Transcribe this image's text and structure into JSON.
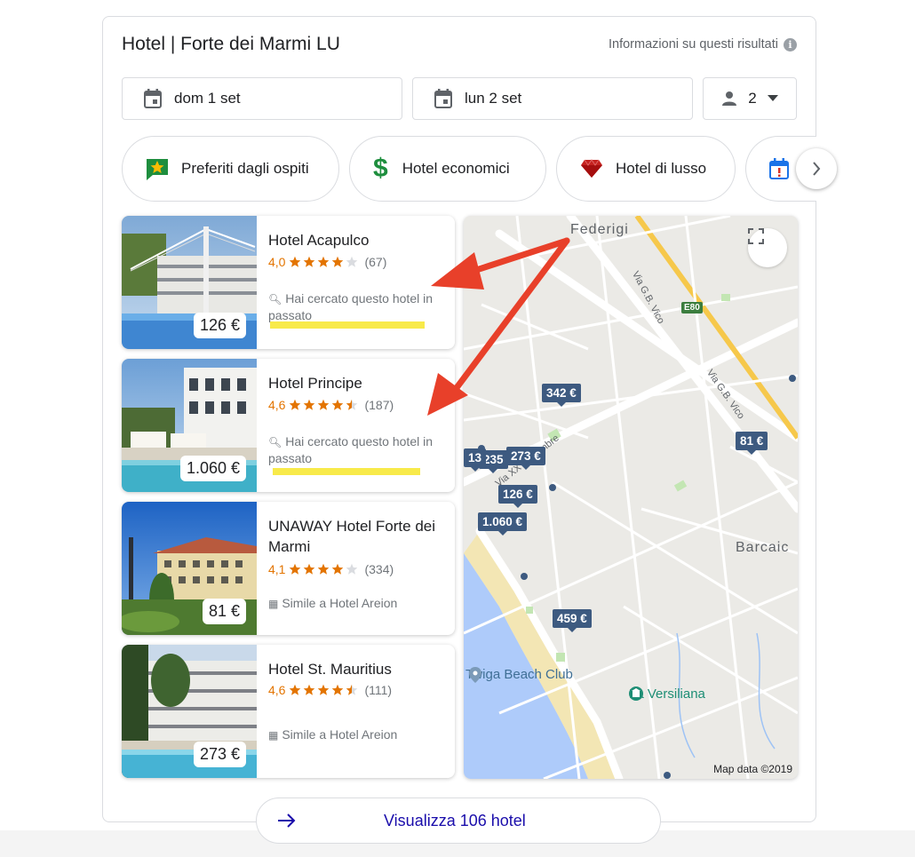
{
  "header": {
    "title": "Hotel | Forte dei Marmi LU",
    "info_link": "Informazioni su questi risultati",
    "info_icon": "info-icon"
  },
  "search": {
    "checkin": "dom 1 set",
    "checkout": "lun 2 set",
    "guests": "2"
  },
  "filters": [
    {
      "label": "Preferiti dagli ospiti",
      "icon": "star-bubble-icon"
    },
    {
      "label": "Hotel economici",
      "icon": "dollar-icon"
    },
    {
      "label": "Hotel di lusso",
      "icon": "gem-icon"
    },
    {
      "label": "",
      "icon": "calendar-alert-icon"
    }
  ],
  "hotels": [
    {
      "name": "Hotel Acapulco",
      "rating": "4,0",
      "stars": 4.0,
      "reviews": "(67)",
      "note": "Hai cercato questo hotel in passato",
      "note_icon": "search-icon",
      "price": "126 €"
    },
    {
      "name": "Hotel Principe",
      "rating": "4,6",
      "stars": 4.6,
      "reviews": "(187)",
      "note": "Hai cercato questo hotel in passato",
      "note_icon": "search-icon",
      "price": "1.060 €"
    },
    {
      "name": "UNAWAY Hotel Forte dei Marmi",
      "rating": "4,1",
      "stars": 4.1,
      "reviews": "(334)",
      "note": "Simile a Hotel Areion",
      "note_icon": "building-icon",
      "price": "81 €"
    },
    {
      "name": "Hotel St. Mauritius",
      "rating": "4,6",
      "stars": 4.6,
      "reviews": "(111)",
      "note": "Simile a Hotel Areion",
      "note_icon": "building-icon",
      "price": "273 €"
    }
  ],
  "map": {
    "labels": [
      "Federigi",
      "Barcaic"
    ],
    "roads": [
      "Via G.B. Vico",
      "Via G.B. Vico",
      "Via XX Settembre"
    ],
    "highway": "E80",
    "pins": [
      "342 €",
      "81 €",
      "273 €",
      "235",
      "13",
      "126 €",
      "1.060 €",
      "459 €"
    ],
    "pois": [
      "Twiga Beach Club",
      "La Versiliana"
    ],
    "credit": "Map data ©2019"
  },
  "footer": {
    "view_all": "Visualizza 106 hotel"
  },
  "colors": {
    "link": "#1a0dab",
    "rating": "#e37400",
    "pin": "#3d5a80",
    "highlight": "#f8ea4a",
    "annotation_arrow": "#e8402a"
  }
}
